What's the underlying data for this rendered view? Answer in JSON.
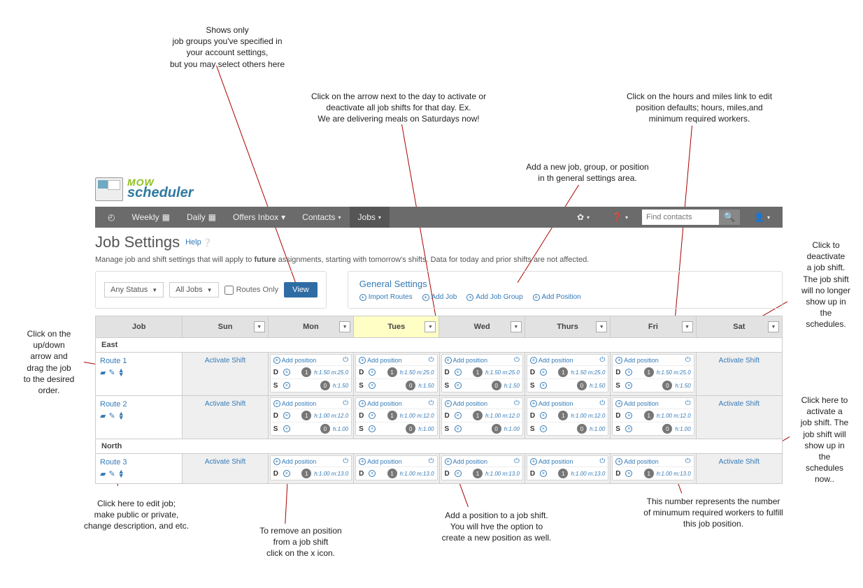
{
  "annotations": {
    "top1": "Shows only\njob groups you've specified in\nyour account settings,\nbut you may select others here",
    "top2": "Click on the arrow next to the day to activate or\ndeactivate all job shifts for that day. Ex.\nWe are delivering meals on Saturdays now!",
    "top3": "Add a new job, group, or position\nin th general settings area.",
    "top4": "Click on the hours and miles link to edit\nposition defaults; hours, miles,and\nminimum required workers.",
    "right1": "Click to\ndeactivate\na job shift.\nThe job shift\nwill no longer\nshow up in\nthe\nschedules.",
    "right2": "Click here to\nactivate a\njob shift. The\njob shift will\nshow up in\nthe\nschedules\nnow..",
    "left1": "Click on the\nup/down\narrow and\ndrag the job\nto the desired\norder.",
    "bot1": "Click here to edit job;\nmake public or private,\nchange description, and etc.",
    "bot2": "To remove an position\nfrom a job shift\nclick on the x icon.",
    "bot3": "Add a position to a job shift.\nYou will hve the option to\ncreate a new position as well.",
    "bot4": "This number represents the number\nof minumum required workers to fulfill\nthis job position."
  },
  "logo": {
    "mow": "MOW",
    "scheduler": "scheduler"
  },
  "nav": {
    "weekly": "Weekly",
    "daily": "Daily",
    "offers": "Offers Inbox",
    "contacts": "Contacts",
    "jobs": "Jobs",
    "search_ph": "Find contacts"
  },
  "page": {
    "title": "Job Settings",
    "help": "Help",
    "subtitle_pre": "Manage job and shift settings that will apply to ",
    "subtitle_bold": "future",
    "subtitle_post": " assignments, starting with tomorrow's shifts. Data for today and prior shifts are not affected."
  },
  "filters": {
    "status": "Any Status",
    "jobs": "All Jobs",
    "routes_only": "Routes Only",
    "view": "View"
  },
  "gsettings": {
    "title": "General Settings",
    "import": "Import Routes",
    "add_job": "Add Job",
    "add_group": "Add Job Group",
    "add_pos": "Add Position"
  },
  "days": [
    "Job",
    "Sun",
    "Mon",
    "Tues",
    "Wed",
    "Thurs",
    "Fri",
    "Sat"
  ],
  "groups": {
    "east": "East",
    "north": "North"
  },
  "labels": {
    "activate": "Activate Shift",
    "addpos": "Add position",
    "D": "D",
    "S": "S"
  },
  "routes": {
    "r1": {
      "name": "Route 1",
      "dhm": "h:1.50 m:25.0",
      "shm": "h:1.50",
      "dbadge": "1",
      "sbadge": "0",
      "has_s": true
    },
    "r2": {
      "name": "Route 2",
      "dhm": "h:1.00 m:12.0",
      "shm": "h:1.00",
      "dbadge": "1",
      "sbadge": "0",
      "has_s": true
    },
    "r3": {
      "name": "Route 3",
      "dhm": "h:1.00 m:13.0",
      "shm": "",
      "dbadge": "1",
      "sbadge": "",
      "has_s": false
    }
  }
}
